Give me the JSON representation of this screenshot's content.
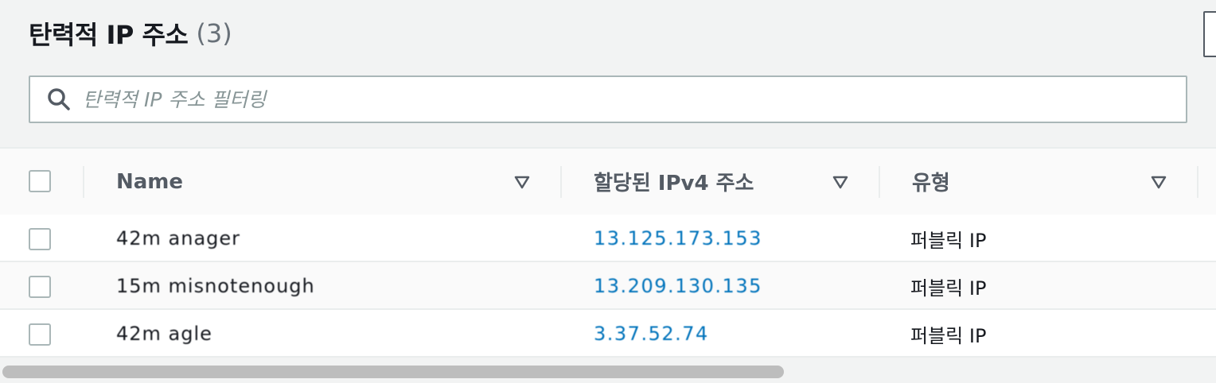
{
  "header": {
    "title": "탄력적 IP 주소",
    "count": "(3)"
  },
  "search": {
    "placeholder": "탄력적 IP 주소 필터링",
    "icon": "search-icon"
  },
  "table": {
    "columns": [
      {
        "label": "Name"
      },
      {
        "label": "할당된 IPv4 주소"
      },
      {
        "label": "유형"
      }
    ],
    "rows": [
      {
        "name": "42m anager",
        "ip": "13.125.173.153",
        "type": "퍼블릭 IP"
      },
      {
        "name": "15m misnotenough",
        "ip": "13.209.130.135",
        "type": "퍼블릭 IP"
      },
      {
        "name": "42m agle",
        "ip": "3.37.52.74",
        "type": "퍼블릭 IP"
      }
    ]
  },
  "colors": {
    "link": "#0073bb",
    "border": "#aab7b8",
    "header_text": "#545b64"
  }
}
